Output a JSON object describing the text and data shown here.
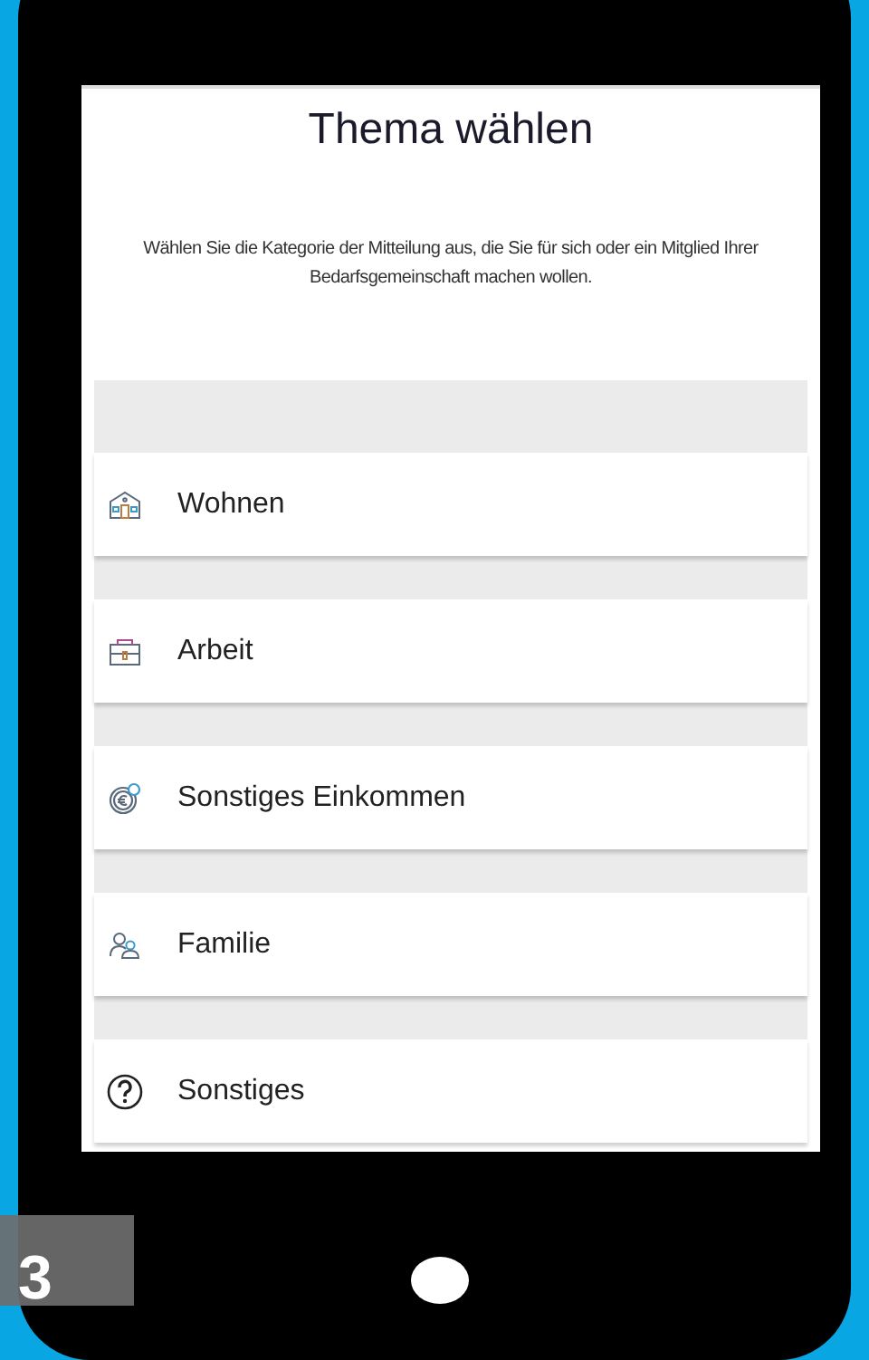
{
  "screen": {
    "title": "Thema wählen",
    "description": "Wählen Sie die Kategorie der Mitteilung aus, die Sie für sich oder ein Mitglied Ihrer Bedarfsgemeinschaft machen wollen.",
    "topics": [
      {
        "label": "Wohnen",
        "kind": "house"
      },
      {
        "label": "Arbeit",
        "kind": "briefcase"
      },
      {
        "label": "Sonstiges Einkommen",
        "kind": "coin"
      },
      {
        "label": "Familie",
        "kind": "people"
      },
      {
        "label": "Sonstiges",
        "kind": "question"
      }
    ]
  },
  "step_badge": "3"
}
